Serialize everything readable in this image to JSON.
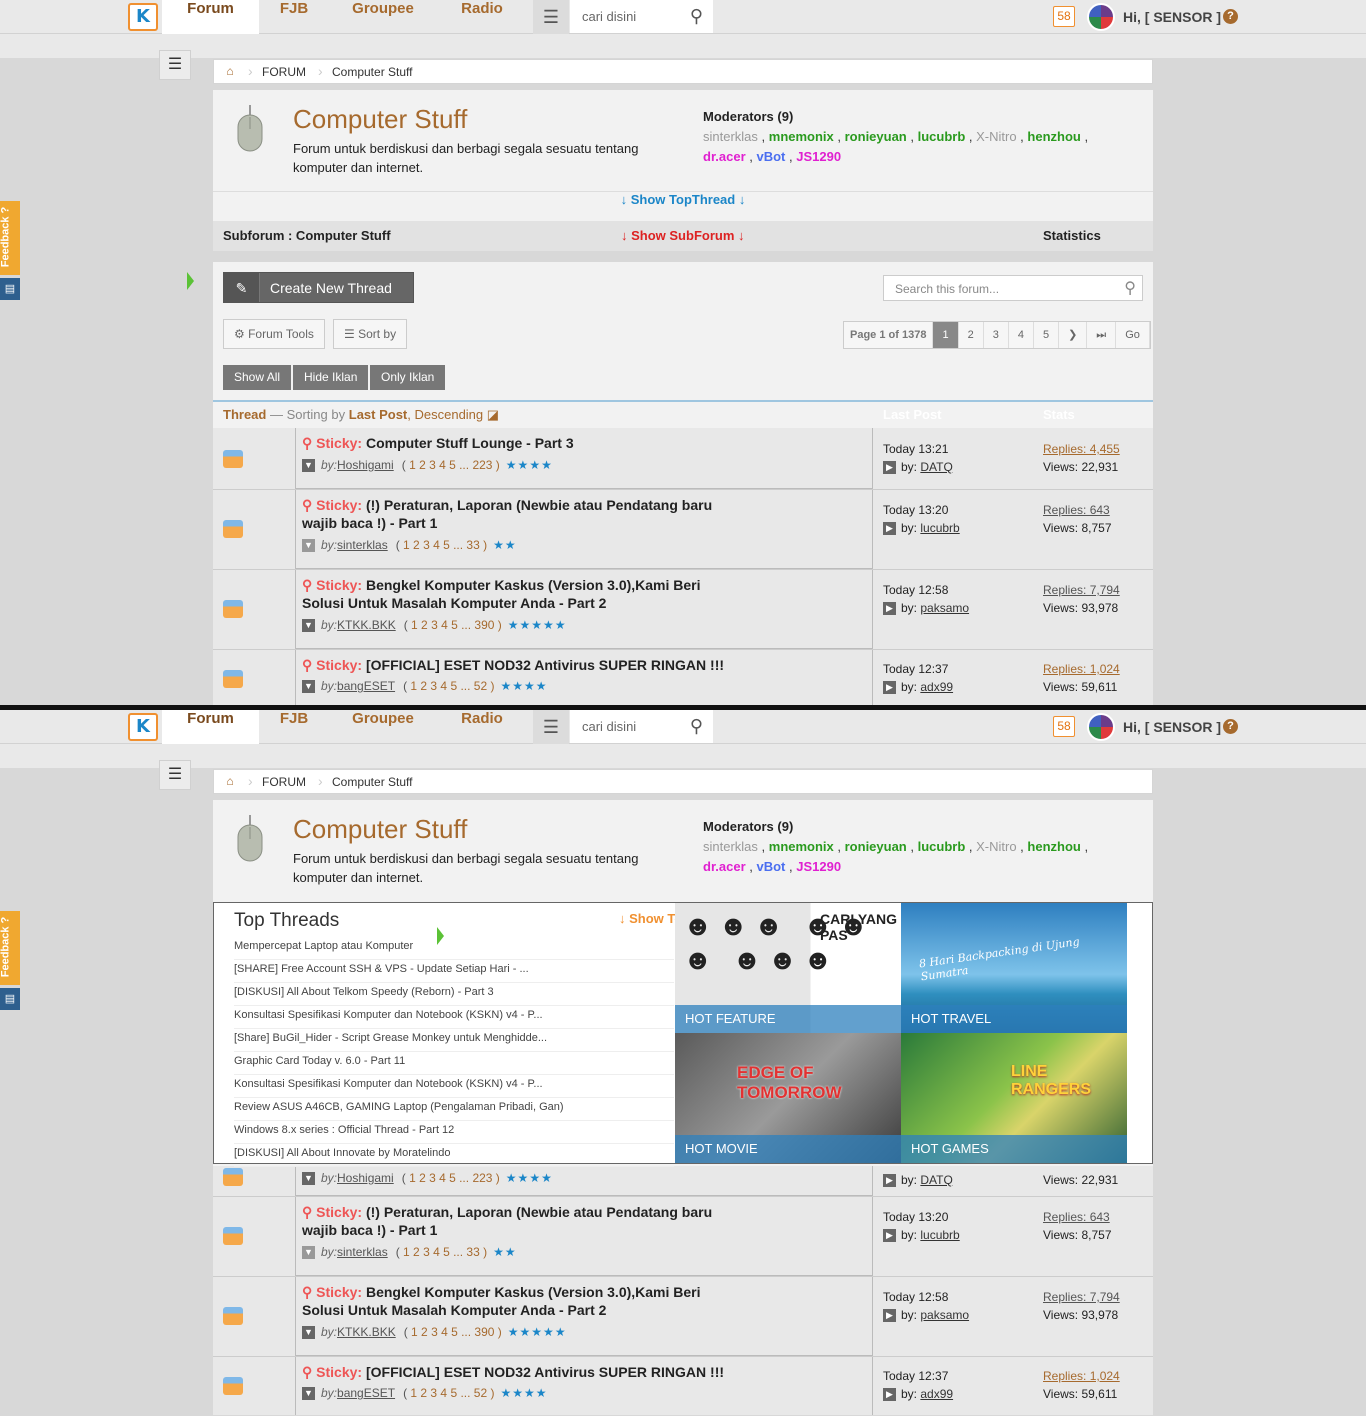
{
  "nav": {
    "logo": "K",
    "items": [
      "Forum",
      "FJB",
      "Groupee",
      "Radio"
    ],
    "search_placeholder": "cari disini",
    "notif_count": "58",
    "greeting": "Hi, [ SENSOR ]",
    "help": "?"
  },
  "breadcrumb": {
    "forum": "FORUM",
    "current": "Computer Stuff"
  },
  "forum": {
    "title": "Computer Stuff",
    "description": "Forum untuk berdiskusi dan berbagi segala sesuatu tentang komputer dan internet.",
    "moderators_label": "Moderators (9)",
    "moderators": [
      "sinterklas",
      "mnemonix",
      "ronieyuan",
      "lucubrb",
      "X-Nitro",
      "henzhou",
      "dr.acer",
      "vBot",
      "JS1290"
    ]
  },
  "toggles": {
    "show_top_thread": "↓ Show TopThread ↓",
    "subforum_label": "Subforum : Computer Stuff",
    "show_subforum": "↓ Show SubForum ↓",
    "statistics": "Statistics"
  },
  "toolbar": {
    "create_thread": "Create New Thread",
    "search_forum_placeholder": "Search this forum...",
    "forum_tools": "Forum Tools",
    "sort_by": "Sort by",
    "page_label": "Page 1 of 1378",
    "pages": [
      "1",
      "2",
      "3",
      "4",
      "5"
    ],
    "go": "Go",
    "filters": [
      "Show All",
      "Hide Iklan",
      "Only Iklan"
    ]
  },
  "thread_header": {
    "thread": "Thread",
    "sorting_prefix": "— Sorting by",
    "sort_field": "Last Post",
    "sort_order": ", Descending",
    "last_post": "Last Post",
    "stats": "Stats"
  },
  "threads": [
    {
      "sticky": "Sticky:",
      "title": "Computer Stuff Lounge - Part 3",
      "by": "by:",
      "author": "Hoshigami",
      "pages": "1 2 3 4 5 ... 223 )",
      "stars": "★★★★",
      "time": "Today 13:21",
      "last_by": "by:",
      "last_user": "DATQ",
      "replies": "Replies: 4,455",
      "views": "Views: 22,931"
    },
    {
      "sticky": "Sticky:",
      "title": "(!) Peraturan, Laporan (Newbie atau Pendatang baru wajib baca !) - Part 1",
      "by": "by:",
      "author": "sinterklas",
      "pages": "1 2 3 4 5 ... 33 )",
      "stars": "★★",
      "time": "Today 13:20",
      "last_by": "by:",
      "last_user": "lucubrb",
      "replies": "Replies: 643",
      "views": "Views: 8,757"
    },
    {
      "sticky": "Sticky:",
      "title": "Bengkel Komputer Kaskus (Version 3.0),Kami Beri Solusi Untuk Masalah Komputer Anda - Part 2",
      "by": "by:",
      "author": "KTKK.BKK",
      "pages": "1 2 3 4 5 ... 390 )",
      "stars": "★★★★★",
      "time": "Today 12:58",
      "last_by": "by:",
      "last_user": "paksamo",
      "replies": "Replies: 7,794",
      "views": "Views: 93,978"
    },
    {
      "sticky": "Sticky:",
      "title": "[OFFICIAL] ESET NOD32 Antivirus SUPER RINGAN !!!",
      "by": "by:",
      "author": "bangESET",
      "pages": "1 2 3 4 5 ... 52 )",
      "stars": "★★★★",
      "time": "Today 12:37",
      "last_by": "by:",
      "last_user": "adx99",
      "replies": "Replies: 1,024",
      "views": "Views: 59,611"
    }
  ],
  "feedback": "Feedback ?",
  "top_threads": {
    "title": "Top Threads",
    "show": "↓ Show TopThread",
    "items": [
      "Mempercepat Laptop atau Komputer",
      "[SHARE] Free Account SSH & VPS - Update Setiap Hari - ...",
      "[DISKUSI] All About Telkom Speedy (Reborn) - Part 3",
      "Konsultasi Spesifikasi Komputer dan Notebook (KSKN) v4 - P...",
      "[Share] BuGil_Hider - Script Grease Monkey untuk Menghidde...",
      "Graphic Card Today v. 6.0 - Part 11",
      "Konsultasi Spesifikasi Komputer dan Notebook (KSKN) v4 - P...",
      "Review ASUS A46CB, GAMING Laptop (Pengalaman Pribadi, Gan)",
      "Windows 8.x series : Official Thread - Part 12",
      "[DISKUSI] All About Innovate by Moratelindo"
    ],
    "tiles": [
      {
        "label": "HOT FEATURE",
        "art": "CARI YANG PAS"
      },
      {
        "label": "HOT TRAVEL",
        "art": "8 Hari Backpacking di Ujung Sumatra"
      },
      {
        "label": "HOT MOVIE",
        "art": "EDGE OF TOMORROW"
      },
      {
        "label": "HOT GAMES",
        "art": "LINE RANGERS"
      }
    ]
  },
  "colors": {
    "brand": "#a66a2e",
    "link_blue": "#1b86c8",
    "sticky": "#e55555"
  }
}
